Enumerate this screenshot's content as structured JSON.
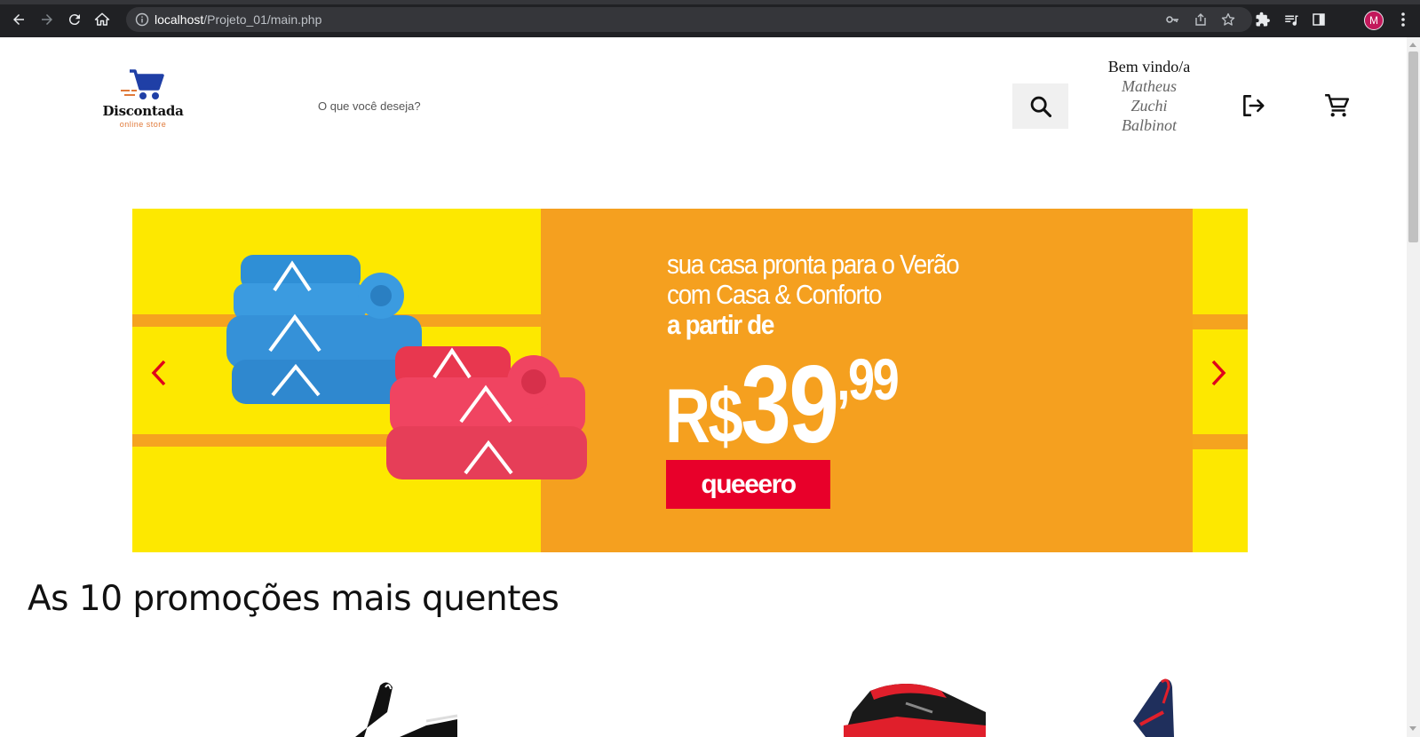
{
  "browser": {
    "url_host": "localhost",
    "url_path": "/Projeto_01/main.php",
    "profile_initial": "M",
    "icons": [
      "back-icon",
      "forward-icon",
      "reload-icon",
      "home-icon",
      "info-icon",
      "key-icon",
      "share-icon",
      "star-icon",
      "extensions-icon",
      "media-icon",
      "sidepanel-icon",
      "menu-icon"
    ]
  },
  "header": {
    "brand": "Discontada",
    "tagline": "online store",
    "search_placeholder": "O que você deseja?",
    "welcome_label": "Bem vindo/a",
    "user_name": "Matheus Zuchi Balbinot"
  },
  "banner": {
    "headline_line1": "sua casa pronta para o Verão",
    "headline_line2": "com Casa & Conforto",
    "headline_line3": "a partir de",
    "price_currency": "R$",
    "price_integer": "39",
    "price_cents": ",99",
    "cta_label": "queeero"
  },
  "section": {
    "title": "As 10 promoções mais quentes"
  },
  "colors": {
    "banner_yellow": "#fde800",
    "banner_orange": "#f5a01f",
    "cta_red": "#e8002a",
    "arrow_red": "#e0001b",
    "logo_blue": "#1f3fa6",
    "logo_orange": "#e07a3a"
  }
}
